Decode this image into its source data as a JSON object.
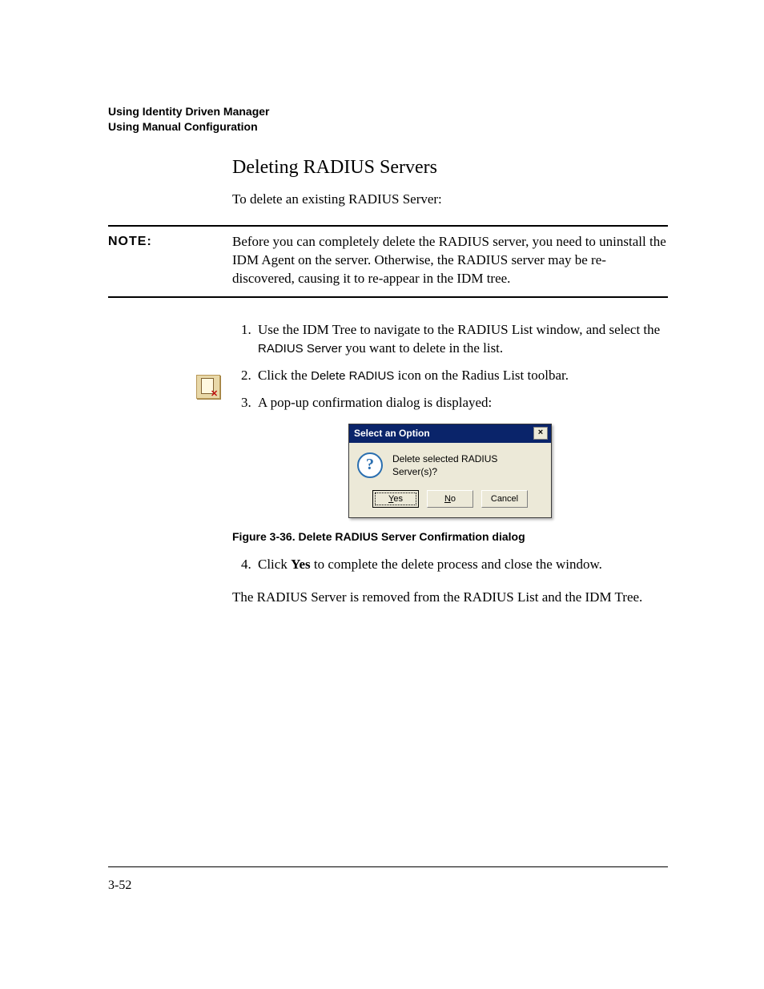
{
  "header": {
    "line1": "Using Identity Driven Manager",
    "line2": "Using Manual Configuration"
  },
  "title": "Deleting RADIUS Servers",
  "intro": "To delete an existing RADIUS Server:",
  "note": {
    "label": "NOTE:",
    "body": "Before you can completely delete the RADIUS server, you need to uninstall the IDM Agent on the server. Otherwise, the RADIUS server may be re-discovered, causing it to re-appear in the IDM tree."
  },
  "steps": {
    "s1_a": "Use the IDM Tree to navigate to the RADIUS List window, and select the ",
    "s1_b": "RADIUS Server",
    "s1_c": " you want to delete in the list.",
    "s2_a": "Click the ",
    "s2_b": "Delete RADIUS",
    "s2_c": " icon on the Radius List toolbar.",
    "s3": "A pop-up confirmation dialog is displayed:",
    "s4_a": "Click ",
    "s4_b": "Yes",
    "s4_c": " to complete the delete process and close the window."
  },
  "dialog": {
    "title": "Select an Option",
    "close": "×",
    "message": "Delete selected RADIUS Server(s)?",
    "buttons": {
      "yes_u": "Y",
      "yes_rest": "es",
      "no_u": "N",
      "no_rest": "o",
      "cancel": "Cancel"
    }
  },
  "figure_caption": "Figure 3-36. Delete RADIUS Server Confirmation dialog",
  "post": "The RADIUS Server is removed from the RADIUS List and the IDM Tree.",
  "page_number": "3-52"
}
